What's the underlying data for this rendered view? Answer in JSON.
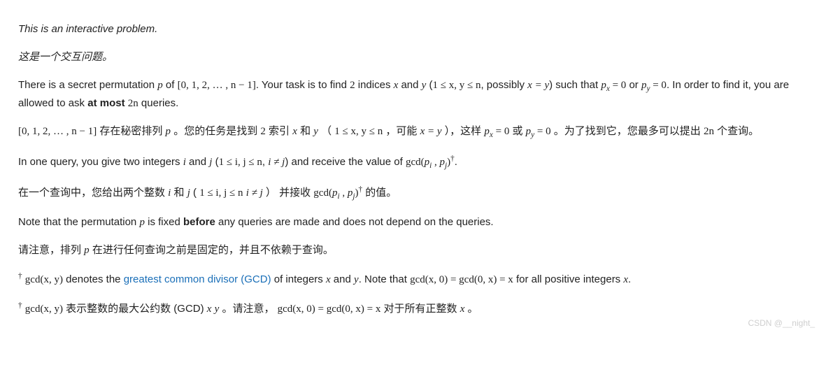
{
  "p1_en": "This is an interactive problem.",
  "p1_zh": "这是一个交互问题。",
  "p2_en": {
    "t1": "There is a secret permutation ",
    "var_p": "p",
    "t2": " of ",
    "set": "[0, 1, 2, … , n − 1]",
    "t3": ". Your task is to find ",
    "two": "2",
    "t4": " indices ",
    "var_x": "x",
    "t5": " and ",
    "var_y": "y",
    "t6": " (",
    "ineq": "1 ≤ x, y ≤ n",
    "t7": ", possibly ",
    "eq_xy": "x = y",
    "t8": ") such that ",
    "px": "p",
    "px_sub": "x",
    "eq0a": " = 0",
    "or": " or ",
    "py": "p",
    "py_sub": "y",
    "eq0b": " = 0",
    "t9": ". In order to find it, you are allowed to ask ",
    "atmost": "at most ",
    "tn": "2n",
    "t10": " queries."
  },
  "p2_zh": {
    "set": "[0, 1, 2, … , n − 1]",
    "t1": " 存在秘密排列 ",
    "var_p": "p",
    "t2": " 。您的任务是找到 ",
    "two": "2",
    "t3": " 索引 ",
    "var_x": "x",
    "t4": " 和 ",
    "var_y": "y",
    "t5": " （ ",
    "ineq": "1 ≤ x, y ≤ n",
    "t6": " ，可能 ",
    "eq_xy": "x = y",
    "t7": " ），这样 ",
    "px": "p",
    "px_sub": "x",
    "eq0a": " = 0",
    "or": " 或 ",
    "py": "p",
    "py_sub": "y",
    "eq0b": " = 0",
    "t8": " 。为了找到它，您最多可以提出 ",
    "tn": "2n",
    "t9": " 个查询。"
  },
  "p3_en": {
    "t1": "In one query, you give two integers ",
    "var_i": "i",
    "t2": " and ",
    "var_j": "j",
    "t3": " (",
    "ineq": "1 ≤ i, j ≤ n",
    "t4": ", ",
    "neq": "i ≠ j",
    "t5": ") and receive the value of ",
    "gcd": "gcd(",
    "pi": "p",
    "pi_sub": "i",
    "comma": " , ",
    "pj": "p",
    "pj_sub": "j",
    "close": ")",
    "dag": "†",
    "t6": "."
  },
  "p3_zh": {
    "t1": "在一个查询中，您给出两个整数 ",
    "var_i": "i",
    "t2": " 和 ",
    "var_j": "j",
    "t3": " ( ",
    "ineq": "1 ≤ i, j ≤ n",
    "sp": " ",
    "neq": "i ≠ j",
    "t4": " ） 并接收 ",
    "gcd": "gcd(",
    "pi": "p",
    "pi_sub": "i",
    "comma": " , ",
    "pj": "p",
    "pj_sub": "j",
    "close": ")",
    "dag": "†",
    "t5": " 的值。"
  },
  "p4_en": {
    "t1": "Note that the permutation ",
    "var_p": "p",
    "t2": " is fixed ",
    "before": "before",
    "t3": " any queries are made and does not depend on the queries."
  },
  "p4_zh": {
    "t1": "请注意，排列 ",
    "var_p": "p",
    "t2": " 在进行任何查询之前是固定的，并且不依赖于查询。"
  },
  "p5_en": {
    "dag": "†",
    "sp": " ",
    "gcd": "gcd(x, y)",
    "t1": " denotes the ",
    "link": "greatest common divisor (GCD)",
    "t2": " of integers ",
    "var_x": "x",
    "t3": " and ",
    "var_y": "y",
    "t4": ". Note that ",
    "eq1": "gcd(x, 0) = gcd(0, x) = x",
    "t5": " for all positive integers ",
    "var_x2": "x",
    "t6": "."
  },
  "p5_zh": {
    "dag": "†",
    "sp": " ",
    "gcd": "gcd(x, y)",
    "t1": " 表示整数的最大公约数 (GCD) ",
    "var_x": "x",
    "sp2": " ",
    "var_y": "y",
    "t2": " 。请注意， ",
    "eq1": "gcd(x, 0) = gcd(0, x) = x",
    "t3": " 对于所有正整数 ",
    "var_x2": "x",
    "t4": " 。"
  },
  "watermark": "CSDN @__night_"
}
